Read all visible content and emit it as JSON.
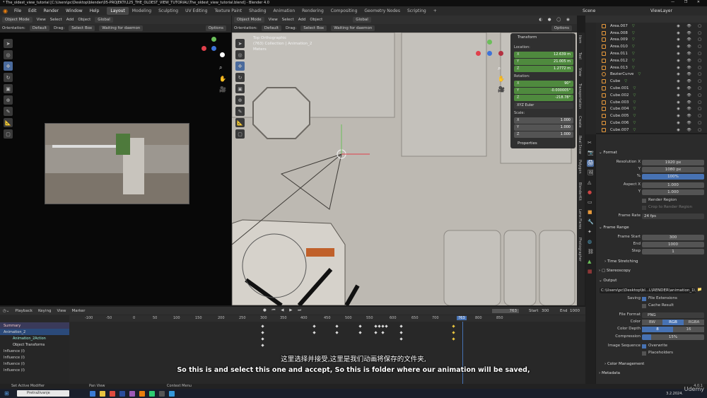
{
  "window_title": "* The_oldest_view_tutorial [C:\\Users\\pc\\Desktop\\blender\\05-PROJEKTI\\125_THE_OLDEST_VIEW_TUTORIAL\\The_oldest_view_tutorial.blend] - Blender 4.0",
  "menu": [
    "File",
    "Edit",
    "Render",
    "Window",
    "Help"
  ],
  "workspaces": [
    "Layout",
    "Modeling",
    "Sculpting",
    "UV Editing",
    "Texture Paint",
    "Shading",
    "Animation",
    "Rendering",
    "Compositing",
    "Geometry Nodes",
    "Scripting"
  ],
  "scene_label": "Scene",
  "viewlayer_label": "ViewLayer",
  "left_view": {
    "mode": "Object Mode",
    "menus": [
      "View",
      "Select",
      "Add",
      "Object"
    ],
    "orientation_label": "Orientation:",
    "orientation": "Default",
    "drag_label": "Drag:",
    "drag": "Select Box",
    "global": "Global",
    "daemon": "Waiting for daemon",
    "options": "Options"
  },
  "right_view": {
    "mode": "Object Mode",
    "menus": [
      "View",
      "Select",
      "Add",
      "Object"
    ],
    "orientation_label": "Orientation:",
    "orientation": "Default",
    "drag_label": "Drag:",
    "drag": "Select Box",
    "global": "Global",
    "daemon": "Waiting for daemon",
    "options": "Options",
    "info_line1": "Top Orthographic",
    "info_line2": "(763) Collection | Animation_2",
    "info_line3": "Meters"
  },
  "side_tabs": [
    "Item",
    "Tool",
    "View",
    "Transportation",
    "Create",
    "Real Snow",
    "Polygon",
    "BlenderKit",
    "Lens Flares",
    "Photographer"
  ],
  "npanel": {
    "title": "Transform",
    "location_label": "Location:",
    "location": [
      {
        "k": "X",
        "v": "12.639 m"
      },
      {
        "k": "Y",
        "v": "21.005 m"
      },
      {
        "k": "Z",
        "v": "1.2772 m"
      }
    ],
    "rotation_label": "Rotation:",
    "rotation": [
      {
        "k": "X",
        "v": "90°"
      },
      {
        "k": "Y",
        "v": "-0.000005°"
      },
      {
        "k": "Z",
        "v": "-218.78°"
      }
    ],
    "rotation_mode": "XYZ Euler",
    "scale_label": "Scale:",
    "scale": [
      {
        "k": "X",
        "v": "1.000"
      },
      {
        "k": "Y",
        "v": "1.000"
      },
      {
        "k": "Z",
        "v": "1.000"
      }
    ],
    "properties": "Properties"
  },
  "outliner": [
    {
      "name": "Area.007",
      "badge": "true"
    },
    {
      "name": "Area.008",
      "badge": "true"
    },
    {
      "name": "Area.009",
      "badge": "true"
    },
    {
      "name": "Area.010",
      "badge": "true"
    },
    {
      "name": "Area.011",
      "badge": "true"
    },
    {
      "name": "Area.012",
      "badge": "true"
    },
    {
      "name": "Area.013",
      "badge": "true"
    },
    {
      "name": "BezierCurve",
      "badge": "true"
    },
    {
      "name": "Cube",
      "badge": "true"
    },
    {
      "name": "Cube.001",
      "badge": "true"
    },
    {
      "name": "Cube.002",
      "badge": "true"
    },
    {
      "name": "Cube.003",
      "badge": "true"
    },
    {
      "name": "Cube.004",
      "badge": "true"
    },
    {
      "name": "Cube.005",
      "badge": "true"
    },
    {
      "name": "Cube.006",
      "badge": "true"
    },
    {
      "name": "Cube.007",
      "badge": "true"
    }
  ],
  "properties": {
    "format": "Format",
    "res_x_label": "Resolution X",
    "res_x": "1920 px",
    "res_y_label": "Y",
    "res_y": "1080 px",
    "res_pct_label": "%",
    "res_pct": "100%",
    "aspect_x_label": "Aspect X",
    "aspect_x": "1.000",
    "aspect_y_label": "Y",
    "aspect_y": "1.000",
    "render_region": "Render Region",
    "crop": "Crop to Render Region",
    "frame_rate_label": "Frame Rate",
    "frame_rate": "24 fps",
    "frame_range": "Frame Range",
    "frame_start_label": "Frame Start",
    "frame_start": "300",
    "end_label": "End",
    "end": "1000",
    "step_label": "Step",
    "step": "1",
    "time_stretching": "Time Stretching",
    "stereoscopy": "Stereoscopy",
    "output": "Output",
    "output_path": "C:\\Users\\pc\\Desktop\\bl...L\\RENDER\\animation_1\\",
    "saving_label": "Saving",
    "file_ext": "File Extensions",
    "cache": "Cache Result",
    "file_format_label": "File Format",
    "file_format": "PNG",
    "color_label": "Color",
    "color_bw": "BW",
    "color_rgb": "RGB",
    "color_rgba": "RGBA",
    "depth_label": "Color Depth",
    "depth_8": "8",
    "depth_16": "16",
    "compression_label": "Compression",
    "compression": "15%",
    "image_seq_label": "Image Sequence",
    "overwrite": "Overwrite",
    "placeholders": "Placeholders",
    "color_mgmt": "Color Management",
    "metadata": "Metadata"
  },
  "timeline": {
    "menus": [
      "Playback",
      "Keying",
      "View",
      "Marker"
    ],
    "current_frame": "763",
    "start_label": "Start",
    "start": "300",
    "end_label": "End",
    "end": "1000",
    "ticks": [
      "-100",
      "-50",
      "0",
      "50",
      "100",
      "150",
      "200",
      "250",
      "300",
      "350",
      "400",
      "450",
      "500",
      "550",
      "600",
      "650",
      "700",
      "763",
      "800",
      "850"
    ],
    "channels": [
      "Summary",
      "Animation_2",
      "Animation_2Action",
      "Object Transforms",
      "Influence (I)",
      "Influence (I)",
      "Influence (I)",
      "Influence (I)"
    ]
  },
  "status": {
    "left": "Set Active Modifier",
    "middle": "Pan View",
    "right": "Context Menu",
    "version": "4.0.1"
  },
  "taskbar": {
    "search": "Pretraživanje",
    "time": "3.2.2024."
  },
  "subtitle_cn": "这里选择并接受,这里是我们动画将保存的文件夹,",
  "subtitle_en": "So this is and select this one and accept, So this is folder where our animation will be saved,",
  "watermark": "Udemy"
}
